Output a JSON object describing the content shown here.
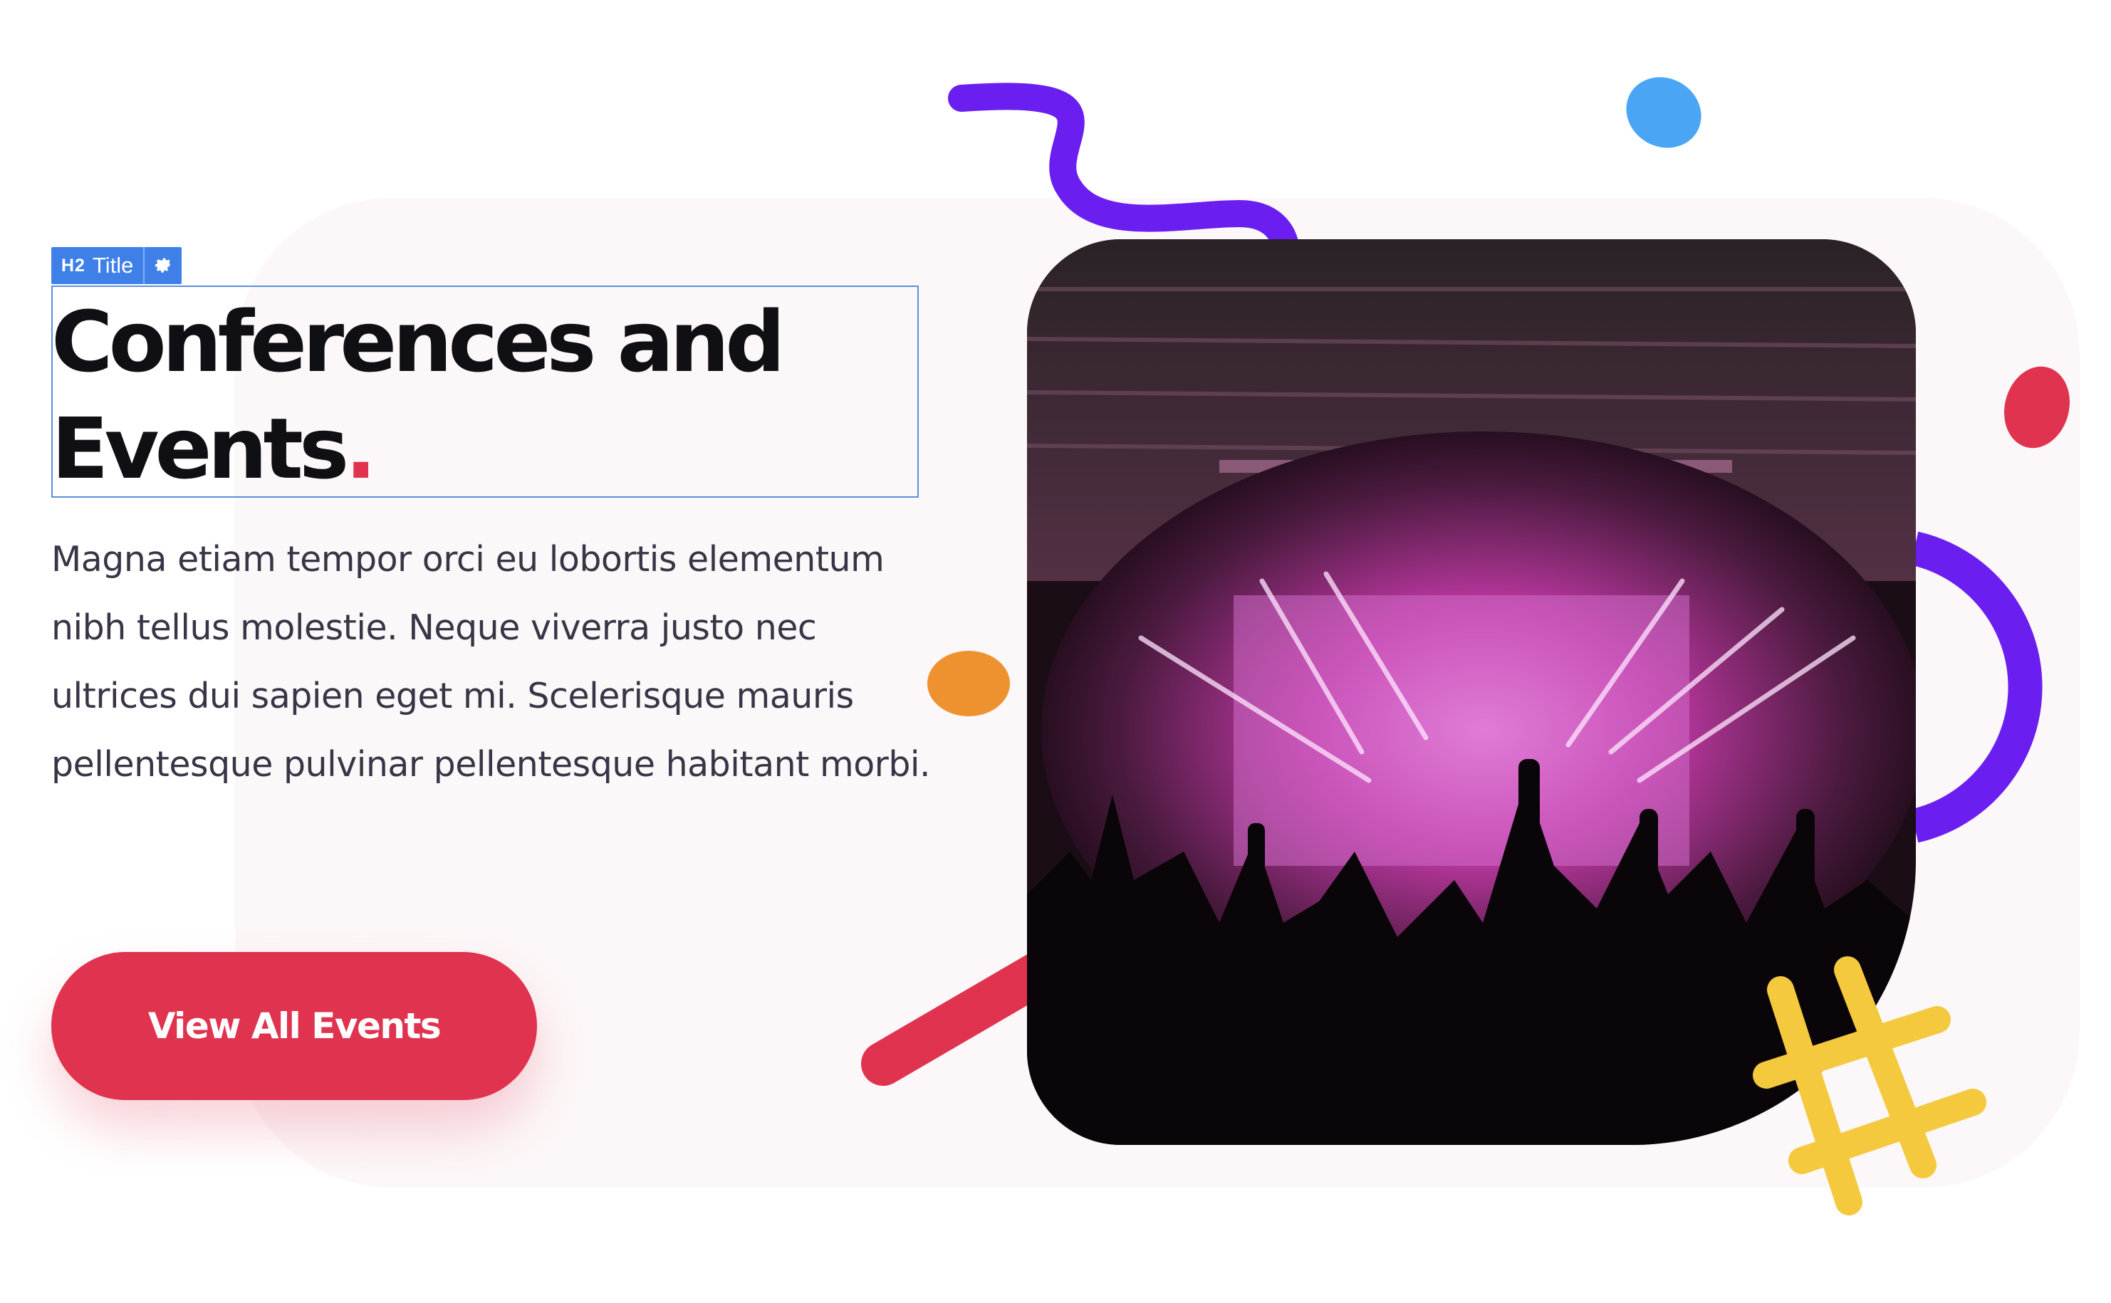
{
  "editor_tag": {
    "heading_level": "H2",
    "label": "Title",
    "settings_icon": "gear-icon"
  },
  "hero": {
    "title_main": "Conferences and Events",
    "title_punct": ".",
    "body": "Magna etiam tempor orci eu lobortis elementum nibh tellus molestie. Neque viverra justo nec ultrices dui sapien eget mi. Scelerisque mauris pellentesque pulvinar pellentesque habitant morbi.",
    "cta_label": "View All Events"
  },
  "image": {
    "subject": "concert-crowd-photo"
  },
  "colors": {
    "accent_red": "#e0334f",
    "purple": "#6a1ff0",
    "blue": "#4aa6f5",
    "orange": "#ee9230",
    "yellow": "#f4c93d",
    "editor_blue": "#3e80e8",
    "panel_bg": "#fcf7f8",
    "heading": "#0f0f14",
    "body_text": "#3a3546"
  }
}
